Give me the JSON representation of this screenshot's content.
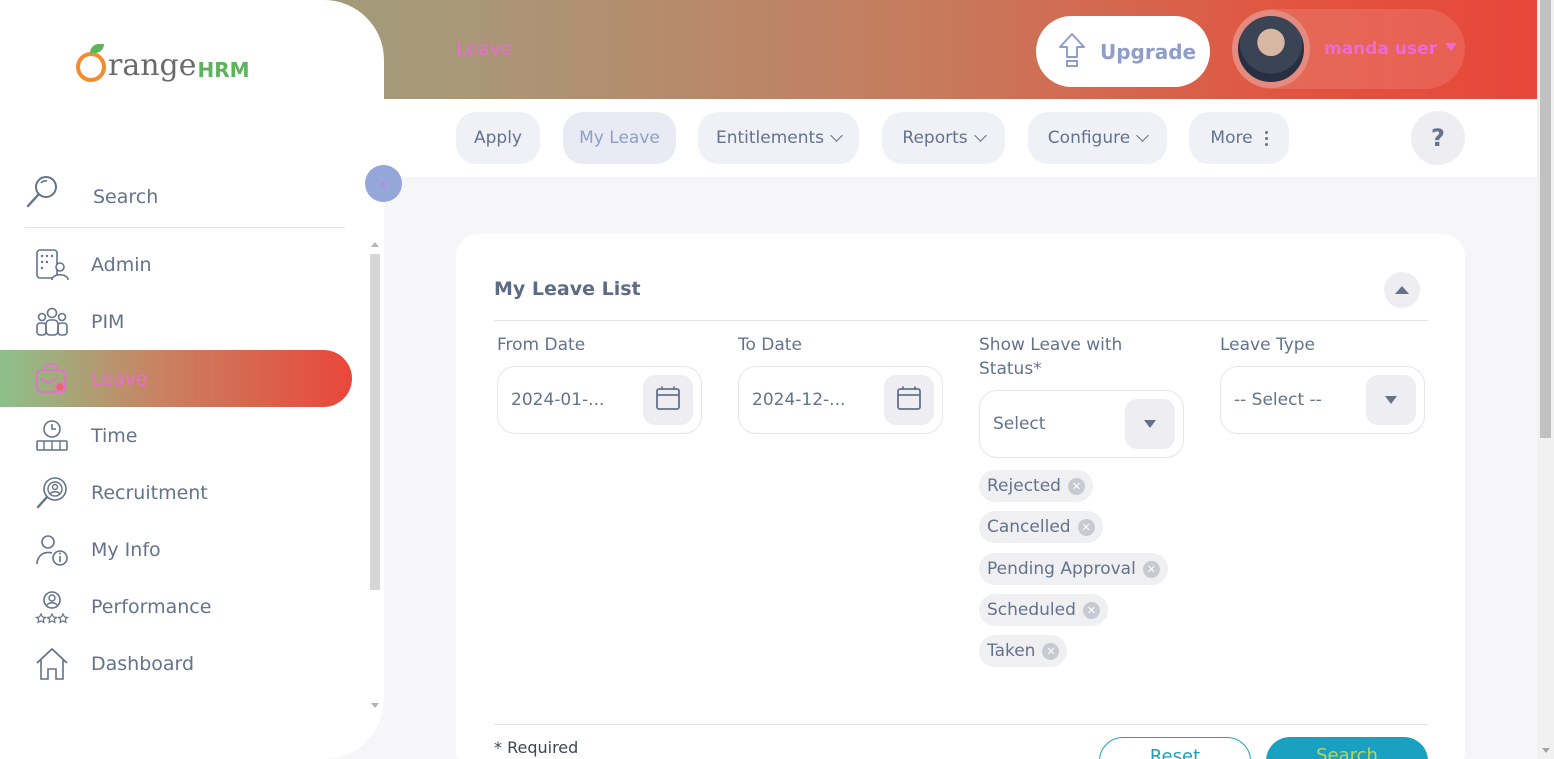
{
  "header": {
    "module_title": "Leave",
    "upgrade_label": "Upgrade",
    "user_name": "manda user"
  },
  "tabs": [
    {
      "label": "Apply",
      "active": false,
      "dropdown": false
    },
    {
      "label": "My Leave",
      "active": true,
      "dropdown": false
    },
    {
      "label": "Entitlements",
      "active": false,
      "dropdown": true
    },
    {
      "label": "Reports",
      "active": false,
      "dropdown": true
    },
    {
      "label": "Configure",
      "active": false,
      "dropdown": true
    },
    {
      "label": "More",
      "active": false,
      "dropdown": false
    }
  ],
  "help_label": "?",
  "sidebar": {
    "logo_text": "range",
    "logo_suffix": "HRM",
    "search_label": "Search",
    "items": [
      {
        "label": "Admin",
        "icon": "admin-icon",
        "active": false
      },
      {
        "label": "PIM",
        "icon": "pim-icon",
        "active": false
      },
      {
        "label": "Leave",
        "icon": "leave-icon",
        "active": true
      },
      {
        "label": "Time",
        "icon": "time-icon",
        "active": false
      },
      {
        "label": "Recruitment",
        "icon": "recruitment-icon",
        "active": false
      },
      {
        "label": "My Info",
        "icon": "my-info-icon",
        "active": false
      },
      {
        "label": "Performance",
        "icon": "performance-icon",
        "active": false
      },
      {
        "label": "Dashboard",
        "icon": "dashboard-icon",
        "active": false
      }
    ]
  },
  "card": {
    "title": "My Leave List",
    "from_date": {
      "label": "From Date",
      "value": "2024-01-..."
    },
    "to_date": {
      "label": "To Date",
      "value": "2024-12-..."
    },
    "status": {
      "label_line1": "Show Leave with",
      "label_line2": "Status*",
      "value": "Select"
    },
    "leave_type": {
      "label": "Leave Type",
      "value": "-- Select --"
    },
    "chips": [
      "Rejected",
      "Cancelled",
      "Pending Approval",
      "Scheduled",
      "Taken"
    ],
    "required_note": "* Required",
    "reset_label": "Reset",
    "search_label": "Search"
  },
  "colors": {
    "accent": "#ec6ad7",
    "primary_button": "#1aa1c2",
    "text": "#64728c"
  }
}
